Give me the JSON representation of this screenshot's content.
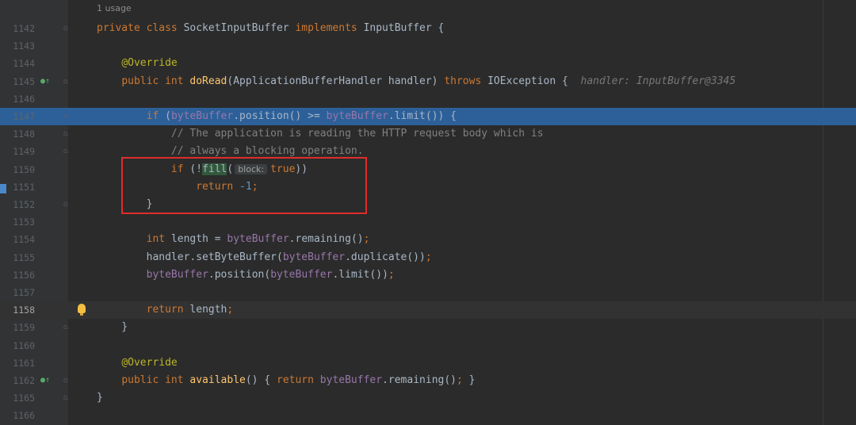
{
  "usage_hint": "1 usage",
  "lines": [
    {
      "num": "1142",
      "tokens": [
        [
          "kw",
          "private class "
        ],
        [
          "",
          "SocketInputBuffer "
        ],
        [
          "kw",
          "implements "
        ],
        [
          "",
          "InputBuffer {"
        ]
      ]
    },
    {
      "num": "1143",
      "tokens": []
    },
    {
      "num": "1144",
      "tokens": [
        [
          "",
          "    "
        ],
        [
          "ann",
          "@Override"
        ]
      ]
    },
    {
      "num": "1145",
      "tokens": [
        [
          "",
          "    "
        ],
        [
          "kw",
          "public int "
        ],
        [
          "fn",
          "doRead"
        ],
        [
          "",
          "(ApplicationBufferHandler handler) "
        ],
        [
          "kw",
          "throws "
        ],
        [
          "",
          "IOException {  "
        ],
        [
          "hint",
          "handler: InputBuffer@3345"
        ]
      ]
    },
    {
      "num": "1146",
      "tokens": []
    },
    {
      "num": "1147",
      "tokens": [
        [
          "",
          "        "
        ],
        [
          "kw",
          "if "
        ],
        [
          "",
          "("
        ],
        [
          "field",
          "byteBuffer"
        ],
        [
          "",
          ".position() >= "
        ],
        [
          "field",
          "byteBuffer"
        ],
        [
          "",
          ".limit()) {"
        ]
      ]
    },
    {
      "num": "1148",
      "tokens": [
        [
          "",
          "            "
        ],
        [
          "cmt",
          "// The application is reading the HTTP request body which is"
        ]
      ]
    },
    {
      "num": "1149",
      "tokens": [
        [
          "",
          "            "
        ],
        [
          "cmt",
          "// always a blocking operation."
        ]
      ]
    },
    {
      "num": "1150",
      "tokens": [
        [
          "",
          "            "
        ],
        [
          "kw",
          "if "
        ],
        [
          "",
          "(!"
        ],
        [
          "match",
          "fill"
        ],
        [
          "",
          "("
        ],
        [
          "param",
          "block:"
        ],
        [
          "kw",
          "true"
        ],
        [
          "",
          "))"
        ]
      ]
    },
    {
      "num": "1151",
      "tokens": [
        [
          "",
          "                "
        ],
        [
          "kw",
          "return "
        ],
        [
          "num",
          "-1"
        ],
        [
          "kw",
          ";"
        ]
      ]
    },
    {
      "num": "1152",
      "tokens": [
        [
          "",
          "        }"
        ]
      ]
    },
    {
      "num": "1153",
      "tokens": []
    },
    {
      "num": "1154",
      "tokens": [
        [
          "",
          "        "
        ],
        [
          "kw",
          "int "
        ],
        [
          "",
          "length = "
        ],
        [
          "field",
          "byteBuffer"
        ],
        [
          "",
          ".remaining()"
        ],
        [
          "kw",
          ";"
        ]
      ]
    },
    {
      "num": "1155",
      "tokens": [
        [
          "",
          "        handler.setByteBuffer("
        ],
        [
          "field",
          "byteBuffer"
        ],
        [
          "",
          ".duplicate())"
        ],
        [
          "kw",
          ";"
        ]
      ]
    },
    {
      "num": "1156",
      "tokens": [
        [
          "",
          "        "
        ],
        [
          "field",
          "byteBuffer"
        ],
        [
          "",
          ".position("
        ],
        [
          "field",
          "byteBuffer"
        ],
        [
          "",
          ".limit())"
        ],
        [
          "kw",
          ";"
        ]
      ]
    },
    {
      "num": "1157",
      "tokens": []
    },
    {
      "num": "1158",
      "tokens": [
        [
          "",
          "        "
        ],
        [
          "kw",
          "return "
        ],
        [
          "",
          "length"
        ],
        [
          "kw",
          ";"
        ]
      ]
    },
    {
      "num": "1159",
      "tokens": [
        [
          "",
          "    }"
        ]
      ]
    },
    {
      "num": "1160",
      "tokens": []
    },
    {
      "num": "1161",
      "tokens": [
        [
          "",
          "    "
        ],
        [
          "ann",
          "@Override"
        ]
      ]
    },
    {
      "num": "1162",
      "tokens": [
        [
          "",
          "    "
        ],
        [
          "kw",
          "public int "
        ],
        [
          "fn",
          "available"
        ],
        [
          "",
          "() { "
        ],
        [
          "kw",
          "return "
        ],
        [
          "field",
          "byteBuffer"
        ],
        [
          "",
          ".remaining()"
        ],
        [
          "kw",
          "; "
        ],
        [
          "",
          "}"
        ]
      ]
    },
    {
      "num": "1165",
      "tokens": [
        [
          "",
          "}"
        ]
      ]
    },
    {
      "num": "1166",
      "tokens": []
    }
  ],
  "highlighted_line": "1147",
  "current_line": "1158",
  "icons": {
    "override_marker": "override-up-arrow-icon",
    "intention_bulb": "lightbulb-icon",
    "fold": "fold-marker-icon"
  },
  "colors": {
    "background": "#2b2b2b",
    "gutter": "#313335",
    "highlight": "#2d6099",
    "keyword": "#cc7832",
    "annotation": "#bbb529",
    "function": "#ffc66d",
    "field": "#9876aa",
    "number": "#6897bb",
    "comment": "#808080",
    "redbox": "#e02c2c"
  }
}
